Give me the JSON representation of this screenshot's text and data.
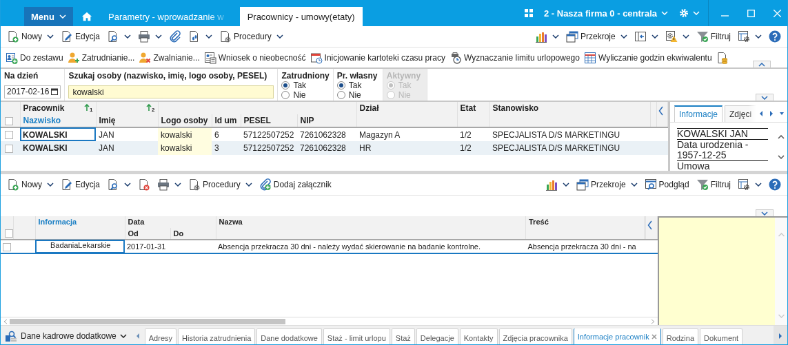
{
  "title_bar": {
    "menu": "Menu",
    "tabs": [
      {
        "label": "Parametry - wprowadzanie w",
        "selected": false
      },
      {
        "label": "Pracownicy - umowy(etaty)",
        "selected": true
      }
    ],
    "company": "2 - Nasza firma 0 - centrala"
  },
  "toolbar": {
    "left": [
      {
        "label": "Nowy",
        "dropdown": true
      },
      {
        "label": "Edycja",
        "dropdown": false
      },
      {
        "dropdown": true
      },
      {
        "dropdown": true
      },
      {
        "dropdown": false
      },
      {
        "dropdown": true
      },
      {
        "label": "Procedury",
        "dropdown": true
      }
    ],
    "right": [
      {
        "dropdown": true
      },
      {
        "label": "Przekroje",
        "dropdown": true
      },
      {
        "dropdown": true
      },
      {
        "dropdown": true
      },
      {
        "label": "Filtruj",
        "dropdown": false
      },
      {
        "dropdown": true
      },
      {
        "dropdown": false
      }
    ]
  },
  "actions": [
    "Do zestawu",
    "Zatrudnianie...",
    "Zwalnianie...",
    "Wniosek o nieobecność",
    "Inicjowanie kartoteki czasu pracy",
    "Wyznaczanie limitu urlopowego",
    "Wyliczanie godzin ekwiwalentu"
  ],
  "filters": {
    "date_label": "Na dzień",
    "date": "2017-02-16",
    "search_label": "Szukaj osoby (nazwisko, imię, logo osoby, PESEL)",
    "search": "kowalski",
    "groups": [
      {
        "label": "Zatrudniony",
        "disabled": false,
        "options": [
          {
            "label": "Tak",
            "selected": true
          },
          {
            "label": "Nie",
            "selected": false
          }
        ]
      },
      {
        "label": "Pr. własny",
        "disabled": false,
        "options": [
          {
            "label": "Tak",
            "selected": true
          },
          {
            "label": "Nie",
            "selected": false
          }
        ]
      },
      {
        "label": "Aktywny",
        "disabled": true,
        "options": [
          {
            "label": "Tak",
            "selected": true
          },
          {
            "label": "Nie",
            "selected": false
          }
        ]
      }
    ]
  },
  "employees": {
    "header_checked": false,
    "columns": [
      {
        "label": "Nazwisko",
        "active": true,
        "grouped": true,
        "group": "Pracownik",
        "sort": "1"
      },
      {
        "label": "Imię",
        "active": false,
        "grouped": true,
        "sort": "2"
      },
      {
        "label": "Logo osoby",
        "active": false,
        "grouped": true
      },
      {
        "label": "Id um",
        "active": false,
        "grouped": true
      },
      {
        "label": "PESEL",
        "active": false,
        "grouped": true
      },
      {
        "label": "NIP",
        "active": false,
        "grouped": true
      },
      {
        "label": "Dział",
        "active": false,
        "grouped": false
      },
      {
        "label": "Etat",
        "active": false,
        "grouped": false
      },
      {
        "label": "Stanowisko",
        "active": false,
        "grouped": false
      }
    ],
    "rows": [
      {
        "checked": false,
        "focused": true,
        "cells": [
          "KOWALSKI",
          "JAN",
          "kowalski",
          "6",
          "57122507252",
          "7261062328",
          "Magazyn A",
          "1/2",
          "SPECJALISTA D/S MARKETINGU"
        ]
      },
      {
        "checked": false,
        "focused": false,
        "cells": [
          "KOWALSKI",
          "JAN",
          "kowalski",
          "3",
          "57122507252",
          "7261062328",
          "HR",
          "1/2",
          "SPECJALISTA D/S MARKETINGU"
        ]
      }
    ]
  },
  "info_panel": {
    "tabs": [
      {
        "label": "Informacje",
        "selected": true
      },
      {
        "label": "Zdjęci",
        "selected": false
      }
    ],
    "lines": [
      "KOWALSKI JAN",
      "Data urodzenia - 1957-12-25",
      "Umowa"
    ]
  },
  "lower_toolbar": {
    "left": [
      {
        "label": "Nowy",
        "dropdown": true
      },
      {
        "label": "Edycja",
        "dropdown": false
      },
      {
        "dropdown": true
      },
      {
        "dropdown": false
      },
      {
        "dropdown": true
      },
      {
        "label": "Procedury",
        "dropdown": true
      },
      {
        "label": "Dodaj załącznik",
        "dropdown": false
      }
    ],
    "right": [
      {
        "dropdown": true
      },
      {
        "label": "Przekroje",
        "dropdown": true
      },
      {
        "label": "Podgląd",
        "dropdown": false
      },
      {
        "label": "Filtruj",
        "dropdown": false
      },
      {
        "dropdown": true
      },
      {
        "dropdown": false
      }
    ]
  },
  "information": {
    "header_checked": false,
    "columns": [
      {
        "label": "Informacja",
        "active": true,
        "grouped": false
      },
      {
        "label": "Od",
        "active": false,
        "grouped": true,
        "group": "Data"
      },
      {
        "label": "Do",
        "active": false,
        "grouped": true
      },
      {
        "label": "Nazwa",
        "active": false,
        "grouped": false
      },
      {
        "label": "Treść",
        "active": false,
        "grouped": false
      }
    ],
    "rows": [
      {
        "checked": false,
        "focused": true,
        "informacja": "BadaniaLekarskie",
        "od": "2017-01-31",
        "nazwa": "Absencja przekracza 30 dni - należy wydać skierowanie na badanie kontrolne.",
        "tresc": "Absencja przekracza 30 dni - na"
      }
    ]
  },
  "bottom_bar": {
    "view": "Dane kadrowe dodatkowe",
    "tabs": [
      {
        "label": "Adresy",
        "selected": false
      },
      {
        "label": "Historia zatrudnienia",
        "selected": false
      },
      {
        "label": "Dane dodatkowe",
        "selected": false
      },
      {
        "label": "Staż - limit urlopu",
        "selected": false
      },
      {
        "label": "Staż",
        "selected": false
      },
      {
        "label": "Delegacje",
        "selected": false
      },
      {
        "label": "Kontakty",
        "selected": false
      },
      {
        "label": "Zdjęcia pracownika",
        "selected": false
      },
      {
        "label": "Informacje pracownik",
        "selected": true
      },
      {
        "label": "Rodzina",
        "selected": false
      },
      {
        "label": "Dokument",
        "selected": false
      }
    ]
  }
}
